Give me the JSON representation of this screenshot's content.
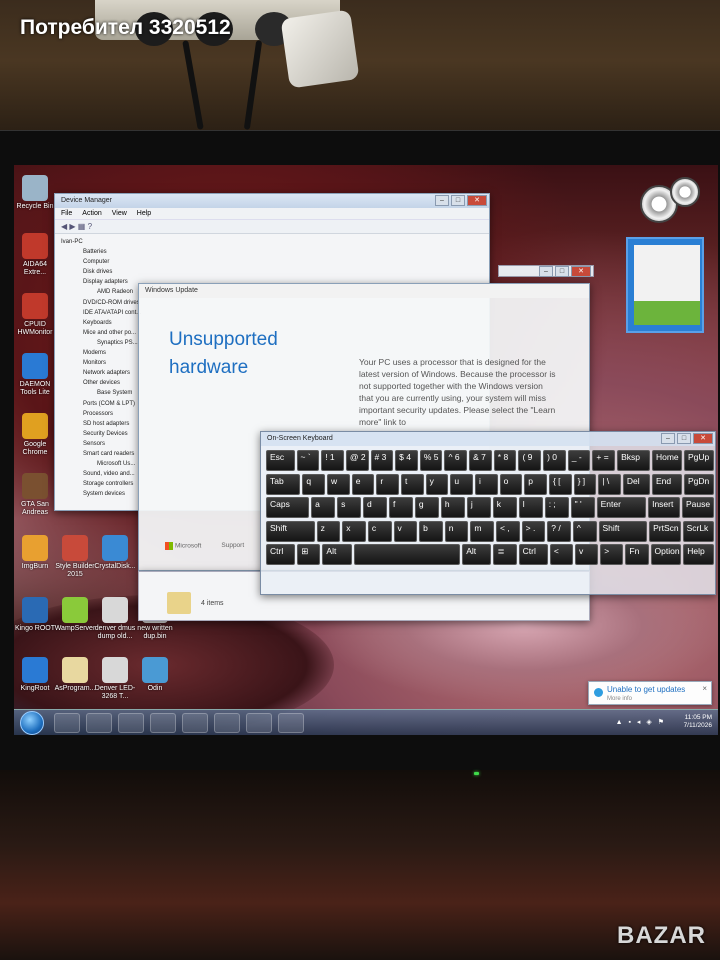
{
  "photo": {
    "owner_overlay": "Потребител 3320512",
    "watermark": "BAZAR"
  },
  "desktop": {
    "icons": [
      {
        "label": "Recycle Bin",
        "color": "#9ab4c8"
      },
      {
        "label": "AIDA64 Extre...",
        "color": "#c0392b"
      },
      {
        "label": "CPUID HWMonitor",
        "color": "#c0392b"
      },
      {
        "label": "DAEMON Tools Lite",
        "color": "#2a7ad4"
      },
      {
        "label": "Google Chrome",
        "color": "#e0a020"
      },
      {
        "label": "GTA San Andreas",
        "color": "#7a5030"
      },
      {
        "label": "ImgBurn",
        "color": "#e8a030"
      },
      {
        "label": "Style Builder 2015",
        "color": "#c84a3a"
      },
      {
        "label": "CrystalDisk...",
        "color": "#3a8ad4"
      },
      {
        "label": "Kingo ROOT",
        "color": "#2a6ab4"
      },
      {
        "label": "WampServer",
        "color": "#8aca3a"
      },
      {
        "label": "denver dmus dump old...",
        "color": "#d8d8d8"
      },
      {
        "label": "new written dup.bin",
        "color": "#d8d8d8"
      },
      {
        "label": "KingRoot",
        "color": "#2a7ad4"
      },
      {
        "label": "AsProgram...",
        "color": "#e8d8a0"
      },
      {
        "label": "Denver LED-3268 T...",
        "color": "#d8d8d8"
      },
      {
        "label": "Odin",
        "color": "#4a9ad4"
      }
    ],
    "tray_time": "11:05 PM",
    "tray_date": "7/11/2026"
  },
  "device_manager": {
    "title": "Device Manager",
    "menu": [
      "File",
      "Action",
      "View",
      "Help"
    ],
    "tree": [
      "Ivan-PC",
      "Batteries",
      "Computer",
      "Disk drives",
      "Display adapters",
      "AMD Radeon",
      "DVD/CD-ROM drives",
      "IDE ATA/ATAPI cont...",
      "Keyboards",
      "Mice and other po...",
      "Synaptics PS...",
      "Modems",
      "Monitors",
      "Network adapters",
      "Other devices",
      "Base System",
      "Ports (COM & LPT)",
      "Processors",
      "SD host adapters",
      "Security Devices",
      "Sensors",
      "Smart card readers",
      "Microsoft Us...",
      "Sound, video and...",
      "Storage controllers",
      "System devices"
    ],
    "status": "4 items"
  },
  "windows_update": {
    "title": "Windows Update",
    "heading": "Unsupported hardware",
    "body": "Your PC uses a processor that is designed for the latest version of Windows. Because the processor is not supported together with the Windows version that you are currently using, your system will miss important security updates. Please select the \"Learn more\" link to",
    "footer_brand": "Microsoft",
    "footer_link": "Support"
  },
  "osk": {
    "title": "On-Screen Keyboard",
    "rows": [
      [
        "Esc",
        "~ `",
        "! 1",
        "@ 2",
        "# 3",
        "$ 4",
        "% 5",
        "^ 6",
        "& 7",
        "* 8",
        "( 9",
        ") 0",
        "_ -",
        "+ =",
        "Bksp",
        "Home",
        "PgUp"
      ],
      [
        "Tab",
        "q",
        "w",
        "e",
        "r",
        "t",
        "y",
        "u",
        "i",
        "o",
        "p",
        "{ [",
        "} ]",
        "| \\",
        "Del",
        "End",
        "PgDn"
      ],
      [
        "Caps",
        "a",
        "s",
        "d",
        "f",
        "g",
        "h",
        "j",
        "k",
        "l",
        ": ;",
        "\" '",
        "Enter",
        "Insert",
        "Pause"
      ],
      [
        "Shift",
        "z",
        "x",
        "c",
        "v",
        "b",
        "n",
        "m",
        "< ,",
        "> .",
        "? /",
        "^",
        "Shift",
        "PrtScn",
        "ScrLk"
      ],
      [
        "Ctrl",
        "⊞",
        "Alt",
        "",
        "Alt",
        "≣",
        "Ctrl",
        "<",
        "v",
        ">",
        "Fn",
        "Options",
        "Help"
      ]
    ]
  },
  "notification": {
    "title": "Unable to get updates",
    "sub": "More info"
  }
}
